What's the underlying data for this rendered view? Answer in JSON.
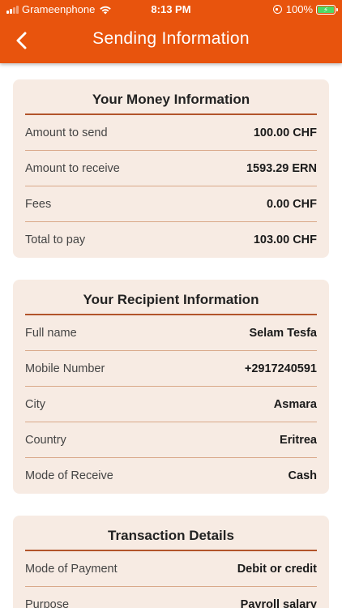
{
  "status_bar": {
    "carrier": "Grameenphone",
    "time": "8:13 PM",
    "battery": "100%"
  },
  "header": {
    "title": "Sending Information"
  },
  "money": {
    "title": "Your Money Information",
    "rows": [
      {
        "label": "Amount to send",
        "value": "100.00 CHF"
      },
      {
        "label": "Amount to receive",
        "value": "1593.29 ERN"
      },
      {
        "label": "Fees",
        "value": "0.00 CHF"
      },
      {
        "label": "Total to pay",
        "value": "103.00 CHF"
      }
    ]
  },
  "recipient": {
    "title": "Your Recipient Information",
    "rows": [
      {
        "label": "Full name",
        "value": "Selam Tesfa"
      },
      {
        "label": "Mobile Number",
        "value": "+2917240591"
      },
      {
        "label": "City",
        "value": "Asmara"
      },
      {
        "label": "Country",
        "value": "Eritrea"
      },
      {
        "label": "Mode of Receive",
        "value": "Cash"
      }
    ]
  },
  "transaction": {
    "title": "Transaction Details",
    "rows": [
      {
        "label": "Mode of Payment",
        "value": "Debit or credit"
      },
      {
        "label": "Purpose",
        "value": "Payroll salary"
      }
    ]
  },
  "colors": {
    "header": "#e8540d",
    "card_bg": "#f7ebe3",
    "title_rule": "#b2542b",
    "row_divider": "#d9a98a"
  },
  "icons": {
    "back": "chevron-left-icon",
    "wifi": "wifi-icon",
    "orientation_lock": "orientation-lock-icon",
    "battery": "battery-charging-icon"
  }
}
